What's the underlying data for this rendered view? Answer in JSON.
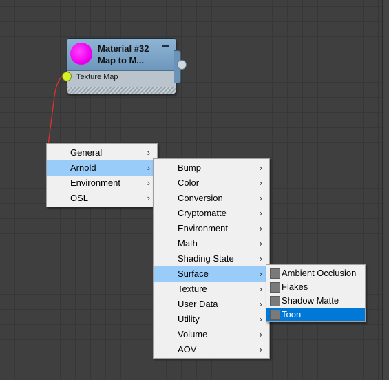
{
  "node": {
    "title_line1": "Material #32",
    "title_line2": "Map to M...",
    "input_label": "Texture Map",
    "preview_color": "#ee00ee",
    "input_socket_color": "#d6f227",
    "wire_color": "#e03030"
  },
  "menu_level1": {
    "items": [
      {
        "label": "General"
      },
      {
        "label": "Arnold"
      },
      {
        "label": "Environment"
      },
      {
        "label": "OSL"
      }
    ],
    "highlighted": "Arnold"
  },
  "menu_level2": {
    "items": [
      {
        "label": "Bump"
      },
      {
        "label": "Color"
      },
      {
        "label": "Conversion"
      },
      {
        "label": "Cryptomatte"
      },
      {
        "label": "Environment"
      },
      {
        "label": "Math"
      },
      {
        "label": "Shading State"
      },
      {
        "label": "Surface"
      },
      {
        "label": "Texture"
      },
      {
        "label": "User Data"
      },
      {
        "label": "Utility"
      },
      {
        "label": "Volume"
      },
      {
        "label": "AOV"
      }
    ],
    "highlighted": "Surface"
  },
  "menu_level3": {
    "items": [
      {
        "label": "Ambient Occlusion",
        "icon": "swatch-icon"
      },
      {
        "label": "Flakes",
        "icon": "swatch-icon"
      },
      {
        "label": "Shadow Matte",
        "icon": "swatch-icon"
      },
      {
        "label": "Toon",
        "icon": "swatch-icon"
      }
    ],
    "selected": "Toon"
  },
  "submenu_arrow": "›"
}
